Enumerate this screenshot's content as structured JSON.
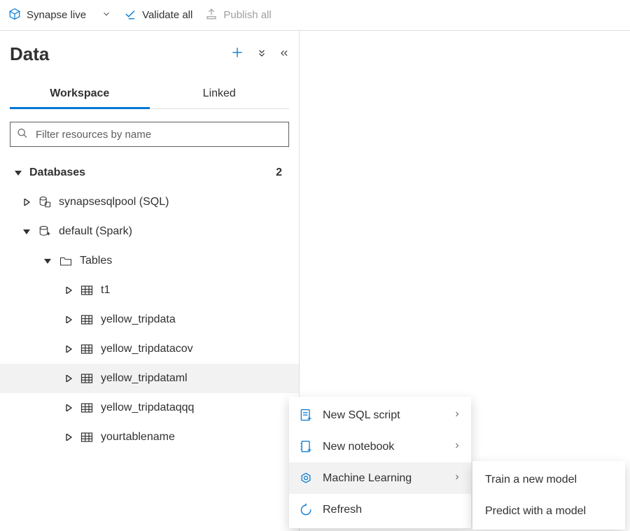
{
  "toolbar": {
    "mode_label": "Synapse live",
    "validate_label": "Validate all",
    "publish_label": "Publish all"
  },
  "pane": {
    "title": "Data"
  },
  "tabs": {
    "workspace": "Workspace",
    "linked": "Linked"
  },
  "filter": {
    "placeholder": "Filter resources by name"
  },
  "tree": {
    "databases_label": "Databases",
    "databases_count": "2",
    "db_sql": "synapsesqlpool (SQL)",
    "db_spark": "default (Spark)",
    "tables_label": "Tables",
    "tables": {
      "t0": "t1",
      "t1": "yellow_tripdata",
      "t2": "yellow_tripdatacov",
      "t3": "yellow_tripdataml",
      "t4": "yellow_tripdataqqq",
      "t5": "yourtablename"
    }
  },
  "context_menu": {
    "new_sql": "New SQL script",
    "new_notebook": "New notebook",
    "ml": "Machine Learning",
    "refresh": "Refresh"
  },
  "submenu": {
    "train": "Train a new model",
    "predict": "Predict with a model"
  }
}
